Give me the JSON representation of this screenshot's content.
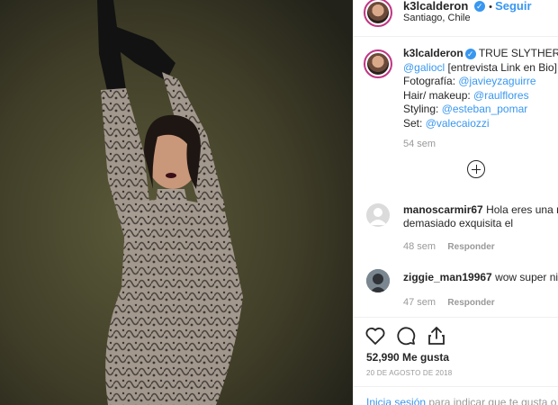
{
  "post": {
    "username": "k3lcalderon",
    "follow_label": "Seguir",
    "location": "Santiago, Chile",
    "photo_description": "Portrait of a woman in a patterned sheer dress and long black gloves with arms raised, dark background"
  },
  "caption": {
    "username": "k3lcalderon",
    "text": "TRUE SLYTHERIN 🐍",
    "line2_mention": "@galiocl",
    "line2_text": " [entrevista Link en Bio]",
    "line3_label": "Fotografía: ",
    "line3_mention": "@javieyzaguirre",
    "line4_label": "Hair/ makeup: ",
    "line4_mention": "@raulflores",
    "line5_label": "Styling: ",
    "line5_mention": "@esteban_pomar",
    "line6_label": "Set: ",
    "line6_mention": "@valecaiozzi",
    "time": "54 sem"
  },
  "comments": [
    {
      "username": "manoscarmir67",
      "text": "Hola eres una mir",
      "text2": "demasiado exquisita el",
      "time": "48 sem",
      "reply": "Responder"
    },
    {
      "username": "ziggie_man19967",
      "text": "wow super nice",
      "time": "47 sem",
      "reply": "Responder"
    }
  ],
  "actions": {
    "likes": "52,990 Me gusta",
    "date": "20 DE AGOSTO DE 2018"
  },
  "login": {
    "link": "Inicia sesión",
    "text": " para indicar que te gusta o"
  },
  "icons": {
    "verified": "verified-badge-icon",
    "like": "heart-icon",
    "comment": "comment-icon",
    "share": "share-icon",
    "load_more": "plus-circle-icon"
  }
}
